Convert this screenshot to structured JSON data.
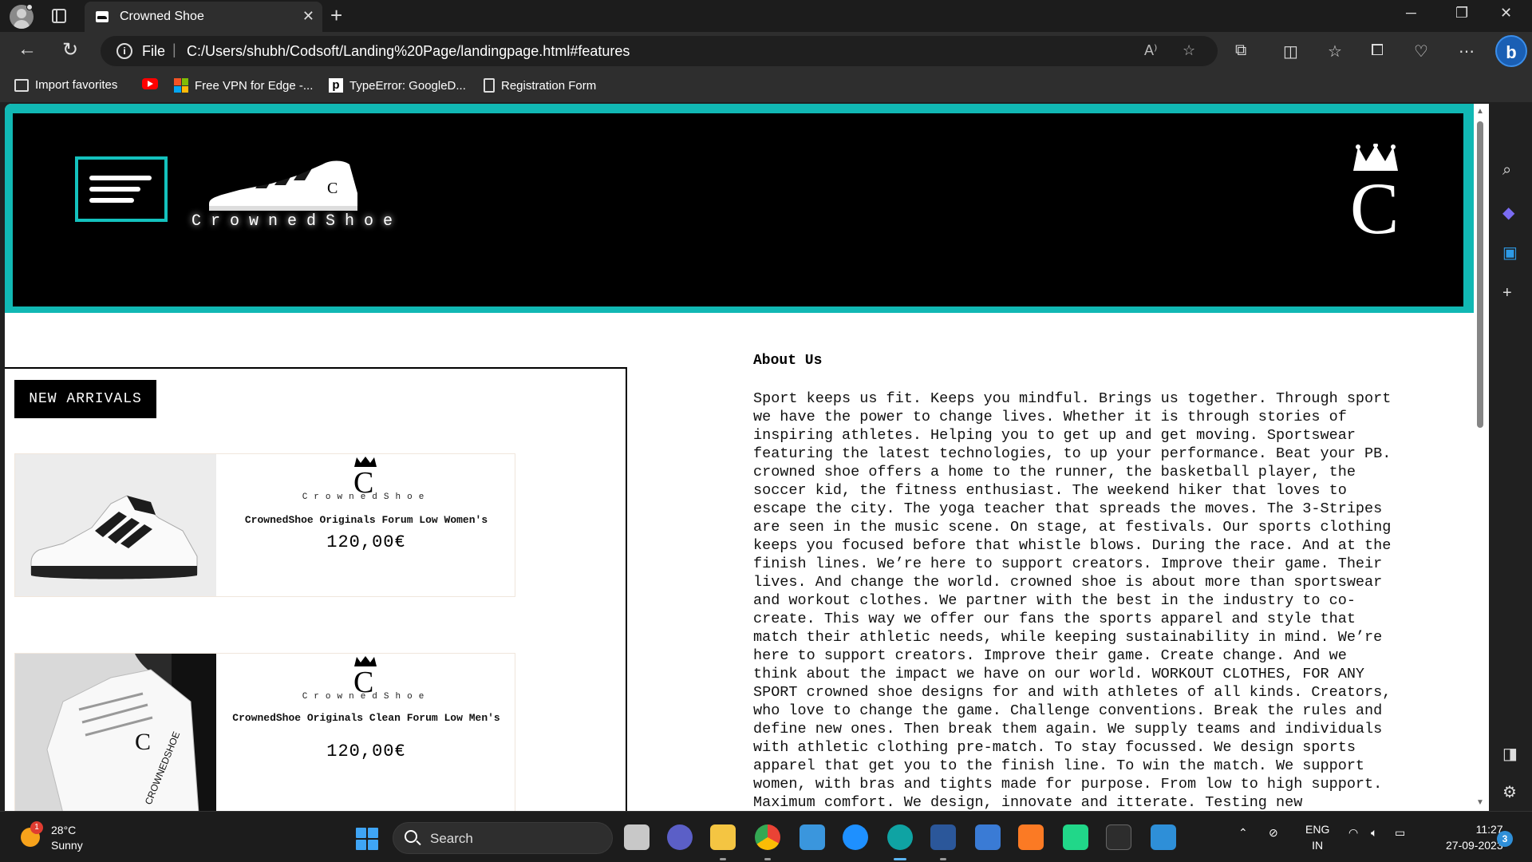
{
  "browser": {
    "tab_title": "Crowned Shoe",
    "scheme": "File",
    "url": "C:/Users/shubh/Codsoft/Landing%20Page/landingpage.html#features",
    "favorites": [
      {
        "label": "Import favorites",
        "icon": "import-favorites-icon"
      },
      {
        "label": "",
        "icon": "youtube-icon"
      },
      {
        "label": "Free VPN for Edge -...",
        "icon": "windows-logo-icon"
      },
      {
        "label": "TypeError: GoogleD...",
        "icon": "p-logo-icon"
      },
      {
        "label": "Registration Form",
        "icon": "document-icon"
      }
    ]
  },
  "page": {
    "brand": "CrownedShoe",
    "new_arrivals_label": "NEW ARRIVALS",
    "products": [
      {
        "brand": "CrownedShoe",
        "name": "CrownedShoe Originals Forum Low Women's",
        "price": "120,00€"
      },
      {
        "brand": "CrownedShoe",
        "name": "CrownedShoe Originals Clean Forum Low Men's",
        "price": "120,00€"
      }
    ],
    "about_title": "About Us",
    "about_text": "Sport keeps us fit. Keeps you mindful. Brings us together. Through sport\nwe have the power to change lives. Whether it is through stories of\ninspiring athletes. Helping you to get up and get moving. Sportswear\nfeaturing the latest technologies, to up your performance. Beat your PB.\ncrowned shoe offers a home to the runner, the basketball player, the\nsoccer kid, the fitness enthusiast. The weekend hiker that loves to\nescape the city. The yoga teacher that spreads the moves. The 3-Stripes\nare seen in the music scene. On stage, at festivals. Our sports clothing\nkeeps you focused before that whistle blows. During the race. And at the\nfinish lines. We’re here to support creators. Improve their game. Their\nlives. And change the world. crowned shoe is about more than sportswear\nand workout clothes. We partner with the best in the industry to co-\ncreate. This way we offer our fans the sports apparel and style that\nmatch their athletic needs, while keeping sustainability in mind. We’re\nhere to support creators. Improve their game. Create change. And we\nthink about the impact we have on our world. WORKOUT CLOTHES, FOR ANY\nSPORT crowned shoe designs for and with athletes of all kinds. Creators,\nwho love to change the game. Challenge conventions. Break the rules and\ndefine new ones. Then break them again. We supply teams and individuals\nwith athletic clothing pre-match. To stay focussed. We design sports\napparel that get you to the finish line. To win the match. We support\nwomen, with bras and tights made for purpose. From low to high support.\nMaximum comfort. We design, innovate and itterate. Testing new"
  },
  "taskbar": {
    "weather_temp": "28°C",
    "weather_cond": "Sunny",
    "weather_badge": "1",
    "search_label": "Search",
    "lang_top": "ENG",
    "lang_bottom": "IN",
    "time": "11:27",
    "date": "27-09-2023",
    "notification_count": "3"
  },
  "colors": {
    "header_accent": "#11b8b4",
    "header_bg": "#000000",
    "page_bg": "#ffffff"
  }
}
